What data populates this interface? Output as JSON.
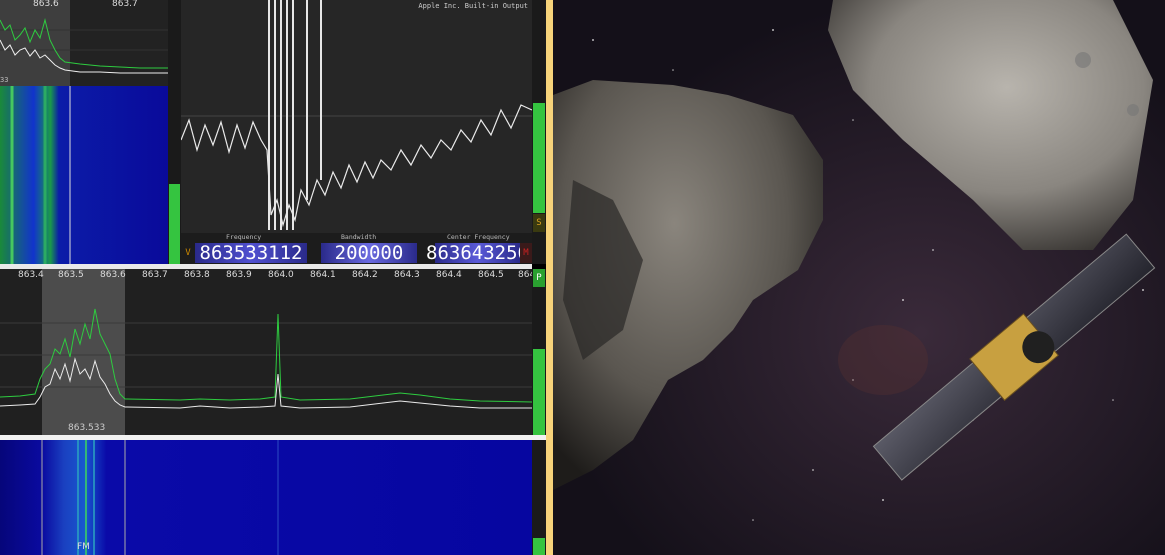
{
  "tl_spectrum": {
    "ticks": [
      "863.6",
      "863.7"
    ],
    "corner_label": "33"
  },
  "scope": {
    "header": "Apple Inc. Built-in Output"
  },
  "readout": {
    "v_tag": "V",
    "m_tag": "M",
    "s_tag": "S",
    "p_tag": "P",
    "frequency_label": "Frequency",
    "bandwidth_label": "Bandwidth",
    "center_label": "Center Frequency",
    "frequency_value": "863533112",
    "bandwidth_value": "200000",
    "center_value": "863643256"
  },
  "main_spectrum": {
    "ticks": [
      "863.4",
      "863.5",
      "863.6",
      "863.7",
      "863.8",
      "863.9",
      "864.0",
      "864.1",
      "864.2",
      "864.3",
      "864.4",
      "864.5",
      "864"
    ],
    "selection_label": "863.533"
  },
  "bottom_waterfall": {
    "mode_label": "FM"
  },
  "colors": {
    "spectrum_green": "#2ecc40",
    "selection_overlay": "#8a8a8a",
    "waterfall_blue": "#0a0ab8",
    "divider_yellow": "#f7d37a"
  }
}
